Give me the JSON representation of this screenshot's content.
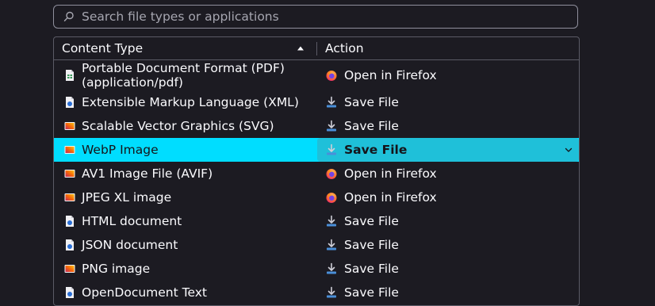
{
  "search": {
    "placeholder": "Search file types or applications",
    "icon": "search-icon"
  },
  "table": {
    "headers": {
      "content_type": "Content Type",
      "action": "Action"
    },
    "sort": "ascending",
    "rows": [
      {
        "type_line1": "Portable Document Format (PDF)",
        "type_line2": "(application/pdf)",
        "type_icon": "pdf-document-icon",
        "action": "Open in Firefox",
        "action_icon": "firefox-icon"
      },
      {
        "type": "Extensible Markup Language (XML)",
        "type_icon": "generic-file-icon",
        "action": "Save File",
        "action_icon": "download-icon"
      },
      {
        "type": "Scalable Vector Graphics (SVG)",
        "type_icon": "image-file-icon",
        "action": "Save File",
        "action_icon": "download-icon"
      },
      {
        "type": "WebP Image",
        "type_icon": "image-file-icon",
        "action": "Save File",
        "action_icon": "download-icon",
        "selected": true
      },
      {
        "type": "AV1 Image File (AVIF)",
        "type_icon": "image-file-icon",
        "action": "Open in Firefox",
        "action_icon": "firefox-icon"
      },
      {
        "type": "JPEG XL image",
        "type_icon": "image-file-icon",
        "action": "Open in Firefox",
        "action_icon": "firefox-icon"
      },
      {
        "type": "HTML document",
        "type_icon": "generic-file-icon",
        "action": "Save File",
        "action_icon": "download-icon"
      },
      {
        "type": "JSON document",
        "type_icon": "generic-file-icon",
        "action": "Save File",
        "action_icon": "download-icon"
      },
      {
        "type": "PNG image",
        "type_icon": "image-file-icon",
        "action": "Save File",
        "action_icon": "download-icon"
      },
      {
        "type": "OpenDocument Text",
        "type_icon": "generic-file-icon",
        "action": "Save File",
        "action_icon": "download-icon"
      }
    ]
  },
  "colors": {
    "background": "#1c1b22",
    "selected_row": "#00ddff",
    "selected_action": "#1fc0d9",
    "border": "#5b5b66",
    "text": "#fbfbfe"
  }
}
